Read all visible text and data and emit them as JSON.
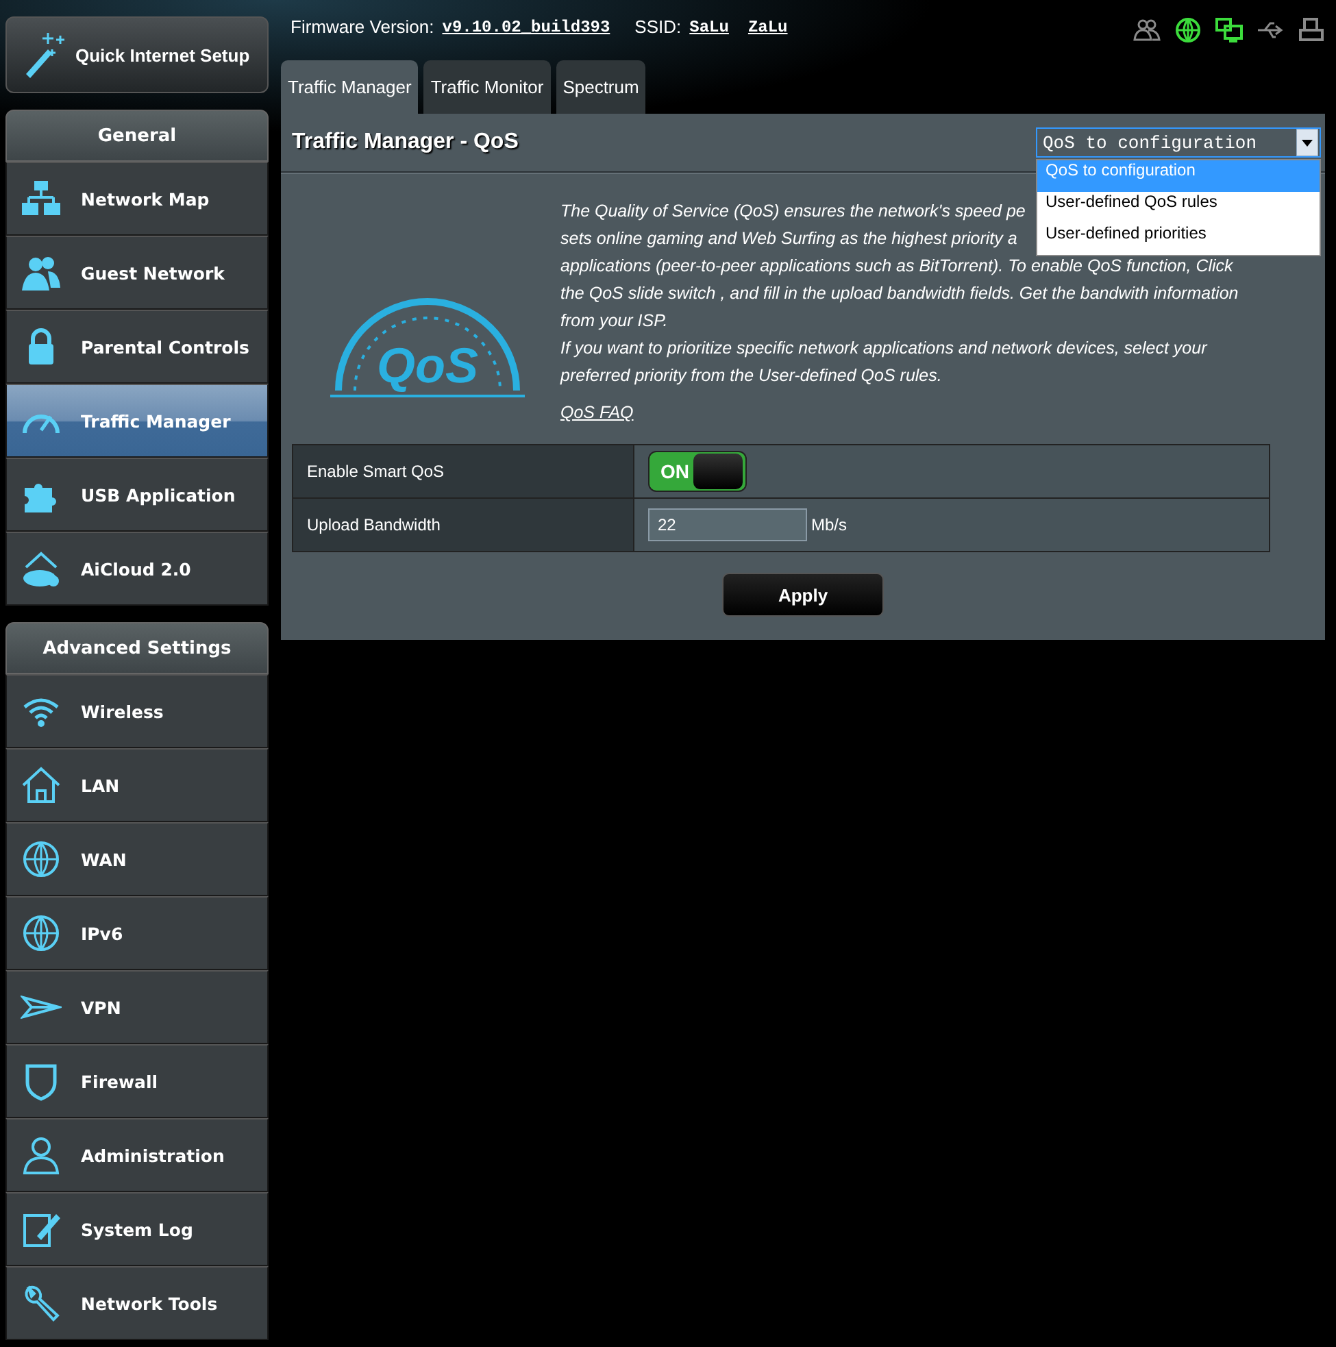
{
  "header": {
    "firmware_label": "Firmware Version:",
    "firmware_value": "v9.10.02_build393",
    "ssid_label": "SSID:",
    "ssids": [
      "SaLu",
      "ZaLu"
    ],
    "status_icons": [
      {
        "kind": "clients",
        "on": false
      },
      {
        "kind": "internet",
        "on": true
      },
      {
        "kind": "network",
        "on": true
      },
      {
        "kind": "usb",
        "on": false
      },
      {
        "kind": "printer",
        "on": false
      }
    ]
  },
  "sidebar": {
    "quick_setup": "Quick Internet Setup",
    "sections": [
      {
        "title": "General",
        "items": [
          {
            "label": "Network Map",
            "selected": false
          },
          {
            "label": "Guest Network",
            "selected": false
          },
          {
            "label": "Parental Controls",
            "selected": false
          },
          {
            "label": "Traffic Manager",
            "selected": true
          },
          {
            "label": "USB Application",
            "selected": false
          },
          {
            "label": "AiCloud 2.0",
            "selected": false
          }
        ]
      },
      {
        "title": "Advanced Settings",
        "items": [
          {
            "label": "Wireless",
            "selected": false
          },
          {
            "label": "LAN",
            "selected": false
          },
          {
            "label": "WAN",
            "selected": false
          },
          {
            "label": "IPv6",
            "selected": false
          },
          {
            "label": "VPN",
            "selected": false
          },
          {
            "label": "Firewall",
            "selected": false
          },
          {
            "label": "Administration",
            "selected": false
          },
          {
            "label": "System Log",
            "selected": false
          },
          {
            "label": "Network Tools",
            "selected": false
          }
        ]
      }
    ]
  },
  "tabs": [
    {
      "label": "Traffic Manager",
      "selected": true
    },
    {
      "label": "Traffic Monitor",
      "selected": false
    },
    {
      "label": "Spectrum",
      "selected": false
    }
  ],
  "panel": {
    "title": "Traffic Manager - QoS",
    "select": {
      "value": "QoS to configuration",
      "expanded": true,
      "options": [
        {
          "label": "QoS to configuration",
          "selected": true
        },
        {
          "label": "User-defined QoS rules",
          "selected": false
        },
        {
          "label": "User-defined priorities",
          "selected": false
        }
      ]
    },
    "logo_text": "QoS",
    "description_lines": [
      "The Quality of Service (QoS) ensures the network's speed pe",
      "sets online gaming and Web Surfing as the highest priority a",
      "applications (peer-to-peer applications such as BitTorrent). To enable QoS function, Click",
      "the QoS slide switch , and fill in the upload bandwidth fields. Get the bandwith information",
      "from your ISP.",
      "If you want to prioritize specific network applications and network devices, select your",
      "preferred priority from the User-defined QoS rules."
    ],
    "faq_link": "QoS FAQ",
    "settings": [
      {
        "kind": "switch",
        "label": "Enable Smart QoS",
        "on": true,
        "on_text": "ON"
      },
      {
        "kind": "input",
        "label": "Upload Bandwidth",
        "value": "22",
        "unit": "Mb/s"
      }
    ],
    "apply": "Apply"
  }
}
